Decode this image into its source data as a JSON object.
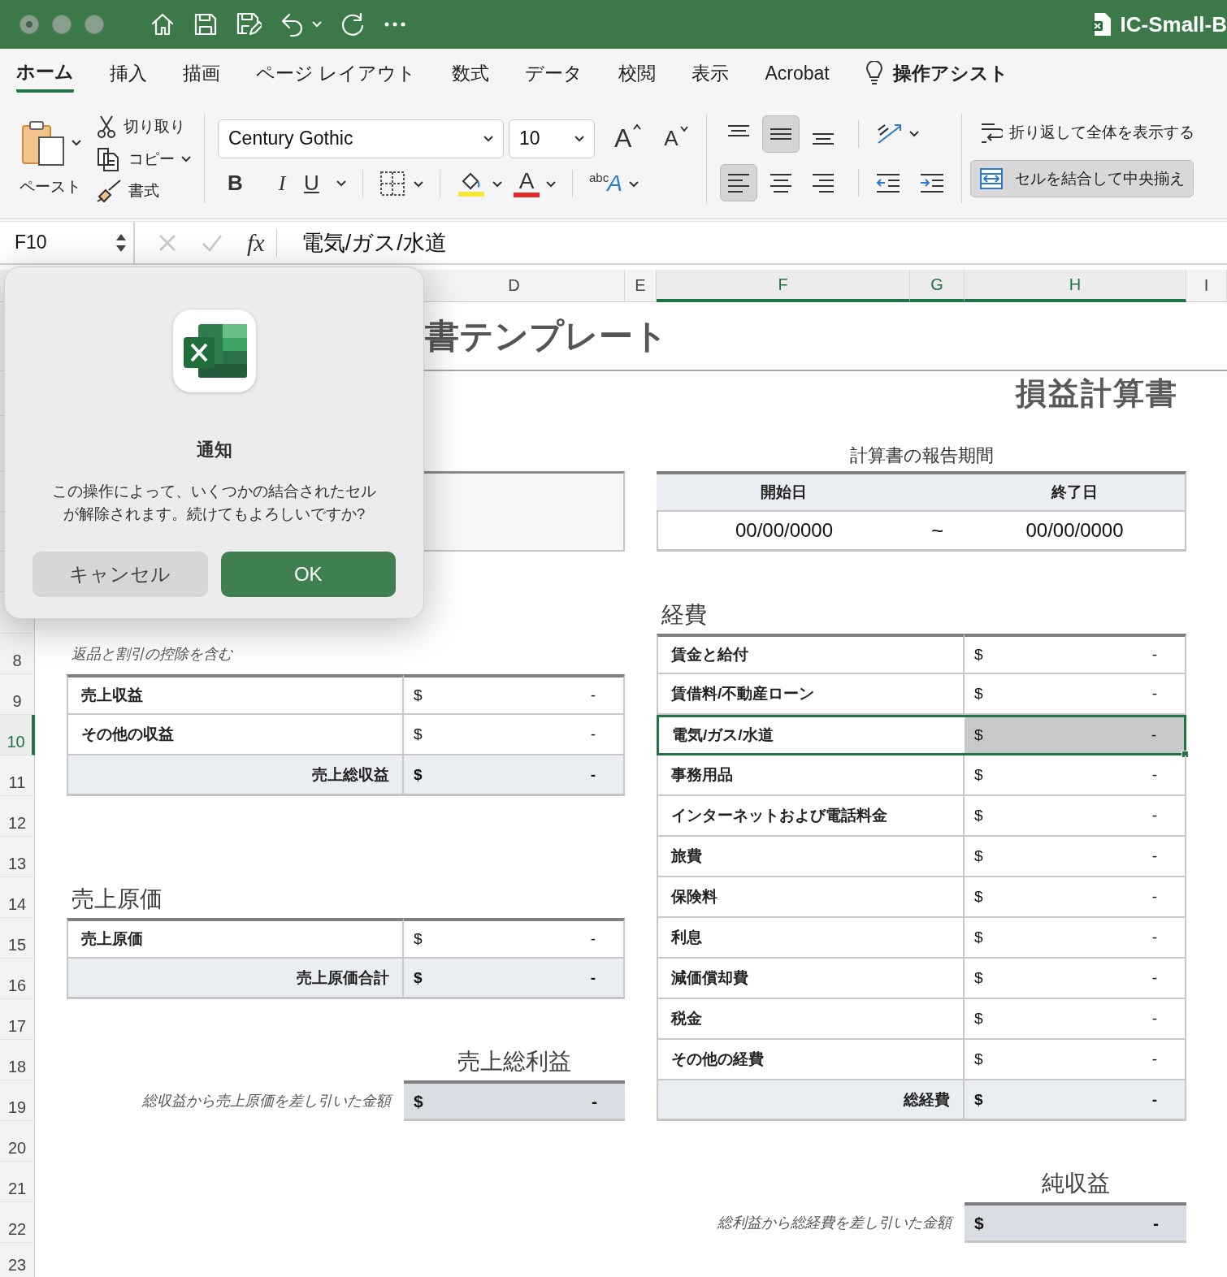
{
  "window": {
    "title": "IC-Small-B"
  },
  "ribbon_tabs": [
    {
      "label": "ホーム",
      "selected": true
    },
    {
      "label": "挿入",
      "selected": false
    },
    {
      "label": "描画",
      "selected": false
    },
    {
      "label": "ページ レイアウト",
      "selected": false
    },
    {
      "label": "数式",
      "selected": false
    },
    {
      "label": "データ",
      "selected": false
    },
    {
      "label": "校閲",
      "selected": false
    },
    {
      "label": "表示",
      "selected": false
    },
    {
      "label": "Acrobat",
      "selected": false
    }
  ],
  "assist": "操作アシスト",
  "ribbon": {
    "clipboard": {
      "paste": "ペースト",
      "cut": "切り取り",
      "copy": "コピー",
      "format_painter": "書式"
    },
    "font": {
      "name": "Century Gothic",
      "size": "10",
      "grow": "A",
      "shrink": "A",
      "bold": "B",
      "italic": "I",
      "underline": "U",
      "font_color": "A",
      "effect_small": "abc",
      "effect_large": "A"
    },
    "vertical_align": [
      {
        "kind": "top",
        "selected": false
      },
      {
        "kind": "middle",
        "selected": true
      },
      {
        "kind": "bottom",
        "selected": false
      }
    ],
    "horizontal_align": [
      {
        "kind": "left",
        "selected": true
      },
      {
        "kind": "center",
        "selected": false
      },
      {
        "kind": "right",
        "selected": false
      }
    ],
    "wrap_text": "折り返して全体を表示する",
    "merge": {
      "label": "セルを結合して中央揃え",
      "selected": true
    }
  },
  "formula_bar": {
    "cell_ref": "F10",
    "fx": "fx",
    "formula": "電気/ガス/水道"
  },
  "columns": [
    {
      "label": "D",
      "selected": false
    },
    {
      "label": "E",
      "selected": false
    },
    {
      "label": "F",
      "selected": true
    },
    {
      "label": "G",
      "selected": true
    },
    {
      "label": "H",
      "selected": true
    },
    {
      "label": "I",
      "selected": false
    }
  ],
  "rows": [
    {
      "label": "8",
      "selected": false
    },
    {
      "label": "9",
      "selected": false
    },
    {
      "label": "10",
      "selected": true
    },
    {
      "label": "11",
      "selected": false
    },
    {
      "label": "12",
      "selected": false
    },
    {
      "label": "13",
      "selected": false
    },
    {
      "label": "14",
      "selected": false
    },
    {
      "label": "15",
      "selected": false
    },
    {
      "label": "16",
      "selected": false
    },
    {
      "label": "17",
      "selected": false
    },
    {
      "label": "18",
      "selected": false
    },
    {
      "label": "19",
      "selected": false
    },
    {
      "label": "20",
      "selected": false
    },
    {
      "label": "21",
      "selected": false
    },
    {
      "label": "22",
      "selected": false
    },
    {
      "label": "23",
      "selected": false
    }
  ],
  "sheet": {
    "title": "書テンプレート",
    "heading": "損益計算書",
    "period": {
      "caption": "計算書の報告期間",
      "start_label": "開始日",
      "end_label": "終了日",
      "start": "00/00/0000",
      "separator": "~",
      "end": "00/00/0000"
    },
    "revenue": {
      "note": "返品と割引の控除を含む",
      "rows": [
        {
          "label": "売上収益",
          "currency": "$",
          "value": "-",
          "kind": "item"
        },
        {
          "label": "その他の収益",
          "currency": "$",
          "value": "-",
          "kind": "item"
        },
        {
          "label": "売上総収益",
          "currency": "$",
          "value": "-",
          "kind": "total"
        }
      ]
    },
    "cogs": {
      "heading": "売上原価",
      "rows": [
        {
          "label": "売上原価",
          "currency": "$",
          "value": "-",
          "kind": "item"
        },
        {
          "label": "売上原価合計",
          "currency": "$",
          "value": "-",
          "kind": "total"
        }
      ]
    },
    "gross_profit": {
      "heading": "売上総利益",
      "note": "総収益から売上原価を差し引いた金額",
      "currency": "$",
      "value": "-"
    },
    "expenses": {
      "heading": "経費",
      "rows": [
        {
          "label": "賃金と給付",
          "currency": "$",
          "value": "-",
          "kind": "item",
          "selected": false
        },
        {
          "label": "賃借料/不動産ローン",
          "currency": "$",
          "value": "-",
          "kind": "item",
          "selected": false
        },
        {
          "label": "電気/ガス/水道",
          "currency": "$",
          "value": "-",
          "kind": "item",
          "selected": true
        },
        {
          "label": "事務用品",
          "currency": "$",
          "value": "-",
          "kind": "item",
          "selected": false
        },
        {
          "label": "インターネットおよび電話料金",
          "currency": "$",
          "value": "-",
          "kind": "item",
          "selected": false
        },
        {
          "label": "旅費",
          "currency": "$",
          "value": "-",
          "kind": "item",
          "selected": false
        },
        {
          "label": "保険料",
          "currency": "$",
          "value": "-",
          "kind": "item",
          "selected": false
        },
        {
          "label": "利息",
          "currency": "$",
          "value": "-",
          "kind": "item",
          "selected": false
        },
        {
          "label": "減価償却費",
          "currency": "$",
          "value": "-",
          "kind": "item",
          "selected": false
        },
        {
          "label": "税金",
          "currency": "$",
          "value": "-",
          "kind": "item",
          "selected": false
        },
        {
          "label": "その他の経費",
          "currency": "$",
          "value": "-",
          "kind": "item",
          "selected": false
        },
        {
          "label": "総経費",
          "currency": "$",
          "value": "-",
          "kind": "total",
          "selected": false
        }
      ]
    },
    "net_income": {
      "heading": "純収益",
      "note": "総利益から総経費を差し引いた金額",
      "currency": "$",
      "value": "-"
    }
  },
  "dialog": {
    "title": "通知",
    "message": "この操作によって、いくつかの結合されたセルが解除されます。続けてもよろしいですか?",
    "buttons": [
      {
        "label": "キャンセル",
        "kind": "secondary"
      },
      {
        "label": "OK",
        "kind": "primary"
      }
    ]
  }
}
